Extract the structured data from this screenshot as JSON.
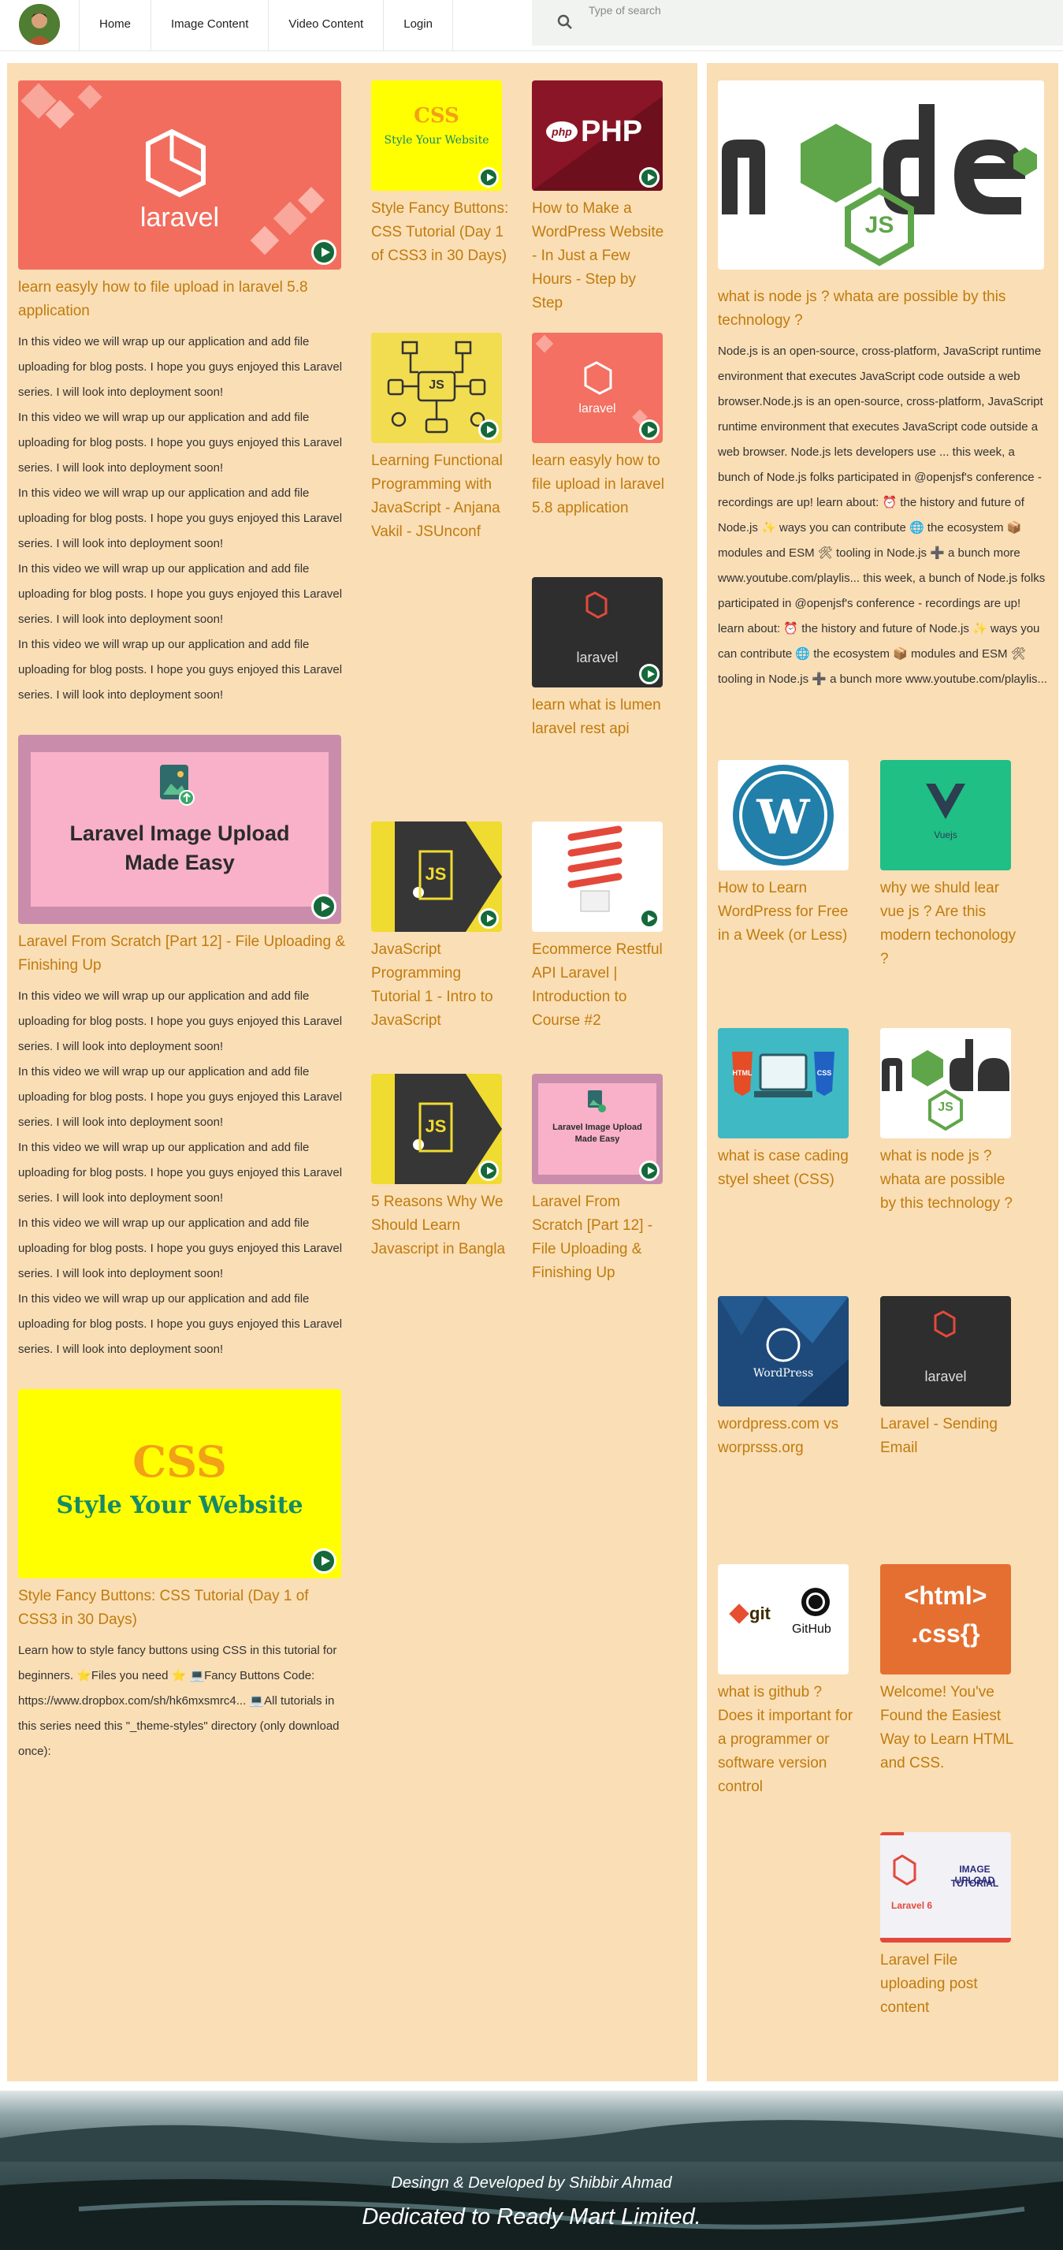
{
  "nav": {
    "links": [
      "Home",
      "Image Content",
      "Video Content",
      "Login"
    ],
    "search_placeholder": "Type of search"
  },
  "main": {
    "big_posts": [
      {
        "title": "learn easyly how to file upload in laravel 5.8 application",
        "thumb_text": "laravel",
        "description": [
          "In this video we will wrap up our application and add file uploading for blog posts. I hope you guys enjoyed this Laravel series. I will look into deployment soon!",
          "In this video we will wrap up our application and add file uploading for blog posts. I hope you guys enjoyed this Laravel series. I will look into deployment soon!",
          "In this video we will wrap up our application and add file uploading for blog posts. I hope you guys enjoyed this Laravel series. I will look into deployment soon!",
          "In this video we will wrap up our application and add file uploading for blog posts. I hope you guys enjoyed this Laravel series. I will look into deployment soon!",
          "In this video we will wrap up our application and add file uploading for blog posts. I hope you guys enjoyed this Laravel series. I will look into deployment soon!"
        ]
      },
      {
        "title": "Laravel From Scratch [Part 12] - File Uploading & Finishing Up",
        "thumb_text_1": "Laravel Image Upload",
        "thumb_text_2": "Made Easy",
        "description": [
          "In this video we will wrap up our application and add file uploading for blog posts. I hope you guys enjoyed this Laravel series. I will look into deployment soon!",
          "In this video we will wrap up our application and add file uploading for blog posts. I hope you guys enjoyed this Laravel series. I will look into deployment soon!",
          "In this video we will wrap up our application and add file uploading for blog posts. I hope you guys enjoyed this Laravel series. I will look into deployment soon!",
          "In this video we will wrap up our application and add file uploading for blog posts. I hope you guys enjoyed this Laravel series. I will look into deployment soon!",
          "In this video we will wrap up our application and add file uploading for blog posts. I hope you guys enjoyed this Laravel series. I will look into deployment soon!"
        ]
      },
      {
        "title": "Style Fancy Buttons: CSS Tutorial (Day 1 of CSS3 in 30 Days)",
        "thumb_text_1": "CSS",
        "thumb_text_2": "Style Your Website",
        "description": [
          "Learn how to style fancy buttons using CSS in this tutorial for beginners. ⭐Files you need ⭐ 💻Fancy Buttons Code: https://www.dropbox.com/sh/hk6mxsmrc4... 💻All tutorials in this series need this \"_theme-styles\" directory (only download once):"
        ]
      }
    ],
    "small_posts": [
      {
        "title": "Style Fancy Buttons: CSS Tutorial (Day 1 of CSS3 in 30 Days)",
        "thumb_text_1": "CSS",
        "thumb_text_2": "Style Your Website"
      },
      {
        "title": "How to Make a WordPress Website - In Just a Few Hours - Step by Step",
        "thumb_text_1": "php",
        "thumb_text_2": "PHP"
      },
      {
        "title": "Learning Functional Programming with JavaScript - Anjana Vakil - JSUnconf",
        "thumb_text_1": "JS"
      },
      {
        "title": "learn easyly how to file upload in laravel 5.8 application",
        "thumb_text_1": "laravel"
      },
      {
        "title": "learn what is lumen laravel rest api",
        "thumb_text_1": "laravel"
      },
      {
        "title": "JavaScript Programming Tutorial 1 - Intro to JavaScript",
        "thumb_text_1": "JS"
      },
      {
        "title": "Ecommerce Restful API Laravel | Introduction to Course #2"
      },
      {
        "title": "5 Reasons Why We Should Learn Javascript in Bangla",
        "thumb_text_1": "JS"
      },
      {
        "title": "Laravel From Scratch [Part 12] - File Uploading & Finishing Up",
        "thumb_text_1": "Laravel Image Upload",
        "thumb_text_2": "Made Easy"
      }
    ]
  },
  "side": {
    "feature": {
      "title": "what is node js ? whata are possible by this technology ?",
      "thumb_text_1": "node",
      "thumb_text_2": "JS",
      "description": "Node.js is an open-source, cross-platform, JavaScript runtime environment that executes JavaScript code outside a web browser.Node.js is an open-source, cross-platform, JavaScript runtime environment that executes JavaScript code outside a web browser. Node.js lets developers use ... this week, a bunch of Node.js folks participated in @openjsf's conference - recordings are up! learn about: ⏰ the history and future of Node.js ✨ ways you can contribute 🌐 the ecosystem 📦 modules and ESM 🛠 tooling in Node.js ➕ a bunch more www.youtube.com/playlis... this week, a bunch of Node.js folks participated in @openjsf's conference - recordings are up! learn about: ⏰ the history and future of Node.js ✨ ways you can contribute 🌐 the ecosystem 📦 modules and ESM 🛠 tooling in Node.js ➕ a bunch more www.youtube.com/playlis..."
    },
    "items": [
      {
        "title": "How to Learn WordPress for Free in a Week (or Less)",
        "thumb_text_1": "W"
      },
      {
        "title": "why we shuld lear vue js ? Are this modern techonology ?",
        "thumb_text_1": "Vuejs"
      },
      {
        "title": "what is case cading styel sheet (CSS)",
        "thumb_text_1": "HTML",
        "thumb_text_2": "CSS"
      },
      {
        "title": "what is node js ? whata are possible by this technology ?",
        "thumb_text_1": "node",
        "thumb_text_2": "JS"
      },
      {
        "title": "wordpress.com vs worprsss.org",
        "thumb_text_1": "WordPress"
      },
      {
        "title": "Laravel - Sending Email",
        "thumb_text_1": "laravel"
      },
      {
        "title": "what is github ? Does it important for a programmer or software version control",
        "thumb_text_1": "git",
        "thumb_text_2": "GitHub"
      },
      {
        "title": "Welcome! You've Found the Easiest Way to Learn HTML and CSS.",
        "thumb_text_1": "<html>",
        "thumb_text_2": ".css{}"
      },
      {
        "title": "Laravel File uploading post content",
        "thumb_text_1": "IMAGE UPLOAD",
        "thumb_text_2": "TUTORIAL",
        "thumb_text_3": "Laravel 6"
      }
    ]
  },
  "footer": {
    "line1": "Desingn & Developed by Shibbir Ahmad",
    "line2": "Dedicated to Ready Mart Limited."
  }
}
